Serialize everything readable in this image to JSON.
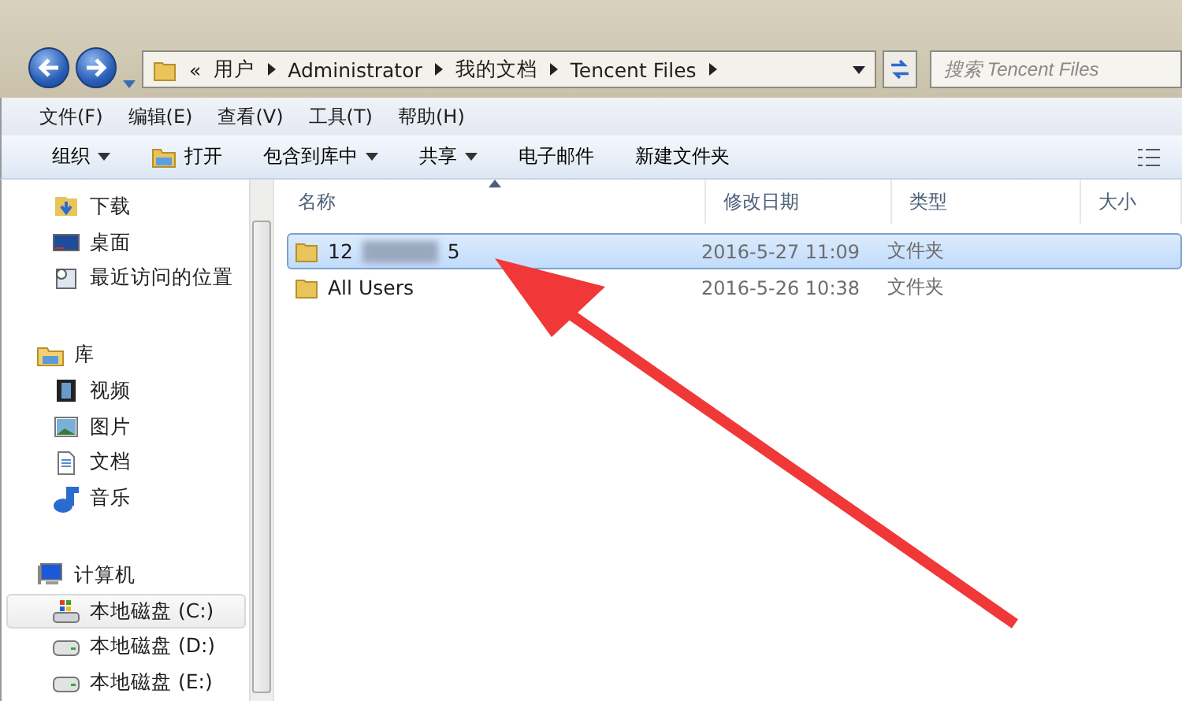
{
  "address_bar": {
    "overflow": "«",
    "crumbs": [
      "用户",
      "Administrator",
      "我的文档",
      "Tencent Files"
    ]
  },
  "search": {
    "placeholder": "搜索 Tencent Files"
  },
  "menu": [
    "文件(F)",
    "编辑(E)",
    "查看(V)",
    "工具(T)",
    "帮助(H)"
  ],
  "toolbar": [
    {
      "label": "组织",
      "kind": "dropdown"
    },
    {
      "label": "打开",
      "kind": "icon"
    },
    {
      "label": "包含到库中",
      "kind": "dropdown"
    },
    {
      "label": "共享",
      "kind": "dropdown"
    },
    {
      "label": "电子邮件",
      "kind": "plain"
    },
    {
      "label": "新建文件夹",
      "kind": "plain"
    }
  ],
  "sidebar": {
    "groups": [
      {
        "items": [
          {
            "label": "下载",
            "kind": "download",
            "selected": false
          },
          {
            "label": "桌面",
            "kind": "desktop",
            "selected": false
          },
          {
            "label": "最近访问的位置",
            "kind": "recent",
            "selected": false
          }
        ]
      },
      {
        "header": {
          "label": "库",
          "kind": "library"
        },
        "items": [
          {
            "label": "视频",
            "kind": "video",
            "selected": false
          },
          {
            "label": "图片",
            "kind": "image",
            "selected": false
          },
          {
            "label": "文档",
            "kind": "document",
            "selected": false
          },
          {
            "label": "音乐",
            "kind": "music",
            "selected": false
          }
        ]
      },
      {
        "header": {
          "label": "计算机",
          "kind": "computer"
        },
        "items": [
          {
            "label": "本地磁盘 (C:)",
            "kind": "systemdrive",
            "selected": true
          },
          {
            "label": "本地磁盘 (D:)",
            "kind": "drive",
            "selected": false
          },
          {
            "label": "本地磁盘 (E:)",
            "kind": "drive",
            "selected": false
          }
        ]
      }
    ]
  },
  "table": {
    "columns": [
      "名称",
      "修改日期",
      "类型",
      "大小"
    ],
    "rows": [
      {
        "name": "12",
        "name_end": "5",
        "redacted": true,
        "modified": "2016-5-27 11:09",
        "type": "文件夹",
        "selected": true
      },
      {
        "name": "All Users",
        "modified": "2016-5-26 10:38",
        "type": "文件夹",
        "selected": false
      }
    ]
  }
}
